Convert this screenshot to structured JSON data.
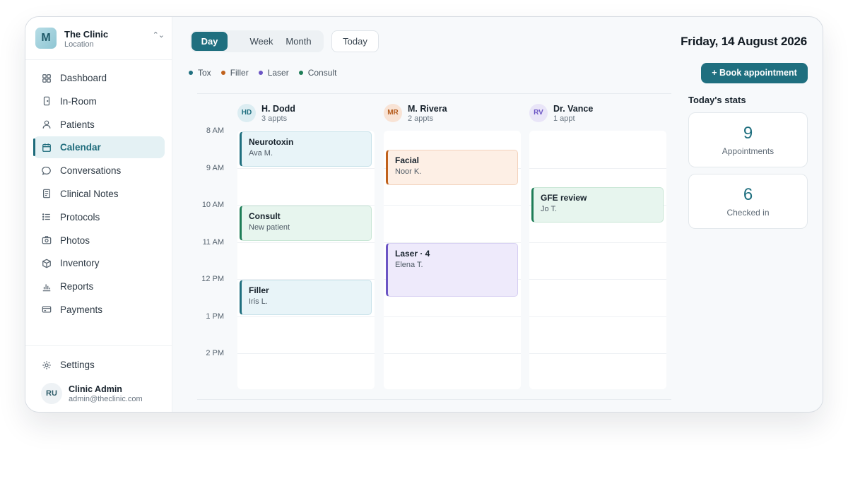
{
  "org": {
    "initial": "M",
    "name": "The Clinic",
    "subtitle": "Location",
    "switch_icon": "chevron-up-down-icon"
  },
  "nav": [
    {
      "label": "Dashboard",
      "icon": "grid-icon"
    },
    {
      "label": "In-Room",
      "icon": "door-icon"
    },
    {
      "label": "Patients",
      "icon": "user-icon"
    },
    {
      "label": "Calendar",
      "icon": "calendar-icon",
      "active": true
    },
    {
      "label": "Conversations",
      "icon": "chat-bubble-icon"
    },
    {
      "label": "Clinical Notes",
      "icon": "note-icon"
    },
    {
      "label": "Protocols",
      "icon": "list-icon"
    },
    {
      "label": "Photos",
      "icon": "camera-icon"
    },
    {
      "label": "Inventory",
      "icon": "box-icon"
    },
    {
      "label": "Reports",
      "icon": "bar-chart-icon"
    },
    {
      "label": "Payments",
      "icon": "credit-card-icon"
    }
  ],
  "settings": {
    "label": "Settings",
    "icon": "gear-icon"
  },
  "user": {
    "initials": "RU",
    "name": "Clinic Admin",
    "email": "admin@theclinic.com"
  },
  "view": {
    "tabs": [
      "Day",
      "Week",
      "Month"
    ],
    "active": "Day",
    "today_label": "Today"
  },
  "date_title": "Friday, 14 August 2026",
  "legend": [
    {
      "label": "Tox",
      "color": "#1f6f7f"
    },
    {
      "label": "Filler",
      "color": "#c0611c"
    },
    {
      "label": "Laser",
      "color": "#6b55c4"
    },
    {
      "label": "Consult",
      "color": "#1e7d57"
    }
  ],
  "book_label": "+ Book appointment",
  "times": [
    "8 AM",
    "9 AM",
    "10 AM",
    "11 AM",
    "12 PM",
    "1 PM",
    "2 PM"
  ],
  "providers": [
    {
      "initials": "HD",
      "name": "H. Dodd",
      "sub": "3 appts",
      "avatar_bg": "#dcedf2",
      "avatar_color": "#1f6f7f",
      "events": [
        {
          "title": "Neurotoxin",
          "patient": "Ava M.",
          "type": "tox",
          "start": 8.0,
          "end": 9.0
        },
        {
          "title": "Consult",
          "patient": "New patient",
          "type": "consult",
          "start": 10.0,
          "end": 11.0
        },
        {
          "title": "Filler",
          "patient": "Iris L.",
          "type": "tox",
          "start": 12.0,
          "end": 13.0
        }
      ]
    },
    {
      "initials": "MR",
      "name": "M. Rivera",
      "sub": "2 appts",
      "avatar_bg": "#f8e3d5",
      "avatar_color": "#b45a1b",
      "events": [
        {
          "title": "Facial",
          "patient": "Noor K.",
          "type": "filler",
          "start": 8.5,
          "end": 9.5
        },
        {
          "title": "Laser · 4",
          "patient": "Elena T.",
          "type": "laser",
          "start": 11.0,
          "end": 12.5
        }
      ]
    },
    {
      "initials": "RV",
      "name": "Dr. Vance",
      "sub": "1 appt",
      "avatar_bg": "#e9e5f8",
      "avatar_color": "#6b55c4",
      "events": [
        {
          "title": "GFE review",
          "patient": "Jo T.",
          "type": "consult",
          "start": 9.5,
          "end": 10.5
        }
      ]
    }
  ],
  "stats": {
    "title": "Today's stats",
    "cards": [
      {
        "value": "9",
        "label": "Appointments"
      },
      {
        "value": "6",
        "label": "Checked in"
      }
    ]
  }
}
